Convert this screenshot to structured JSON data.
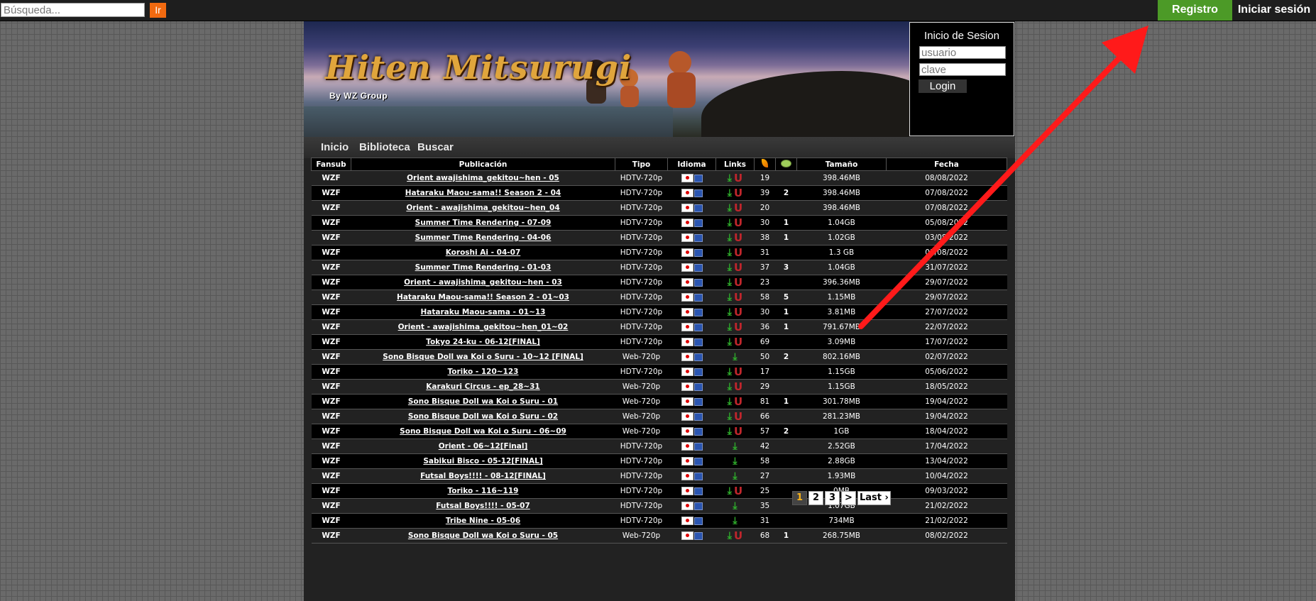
{
  "topbar": {
    "search_placeholder": "Búsqueda...",
    "go_label": "Ir",
    "registro_label": "Registro",
    "iniciar_label": "Iniciar sesión"
  },
  "header": {
    "logo_text": "Hiten Mitsurugi",
    "logo_sub": "By WZ Group"
  },
  "login": {
    "title": "Inicio de Sesion",
    "user_placeholder": "usuario",
    "pass_placeholder": "clave",
    "button": "Login"
  },
  "nav": [
    "Inicio",
    "Biblioteca",
    "Buscar"
  ],
  "table": {
    "headers": [
      "Fansub",
      "Publicación",
      "Tipo",
      "Idioma",
      "Links",
      "seeds-icon",
      "comments-icon",
      "Tamaño",
      "Fecha"
    ],
    "rows": [
      {
        "fansub": "WZF",
        "title": "Orient awajishima_gekitou~hen - 05",
        "tipo": "HDTV-720p",
        "torrent": true,
        "seeds": "19",
        "comments": "",
        "size": "398.46MB",
        "date": "08/08/2022"
      },
      {
        "fansub": "WZF",
        "title": "Hataraku Maou-sama!! Season 2 - 04",
        "tipo": "HDTV-720p",
        "torrent": true,
        "seeds": "39",
        "comments": "2",
        "size": "398.46MB",
        "date": "07/08/2022"
      },
      {
        "fansub": "WZF",
        "title": "Orient - awajishima_gekitou~hen_04",
        "tipo": "HDTV-720p",
        "torrent": true,
        "seeds": "20",
        "comments": "",
        "size": "398.46MB",
        "date": "07/08/2022"
      },
      {
        "fansub": "WZF",
        "title": "Summer Time Rendering - 07-09",
        "tipo": "HDTV-720p",
        "torrent": true,
        "seeds": "30",
        "comments": "1",
        "size": "1.04GB",
        "date": "05/08/2022"
      },
      {
        "fansub": "WZF",
        "title": "Summer Time Rendering - 04-06",
        "tipo": "HDTV-720p",
        "torrent": true,
        "seeds": "38",
        "comments": "1",
        "size": "1.02GB",
        "date": "03/08/2022"
      },
      {
        "fansub": "WZF",
        "title": "Koroshi Ai - 04-07",
        "tipo": "HDTV-720p",
        "torrent": true,
        "seeds": "31",
        "comments": "",
        "size": "1.3 GB",
        "date": "01/08/2022"
      },
      {
        "fansub": "WZF",
        "title": "Summer Time Rendering - 01-03",
        "tipo": "HDTV-720p",
        "torrent": true,
        "seeds": "37",
        "comments": "3",
        "size": "1.04GB",
        "date": "31/07/2022"
      },
      {
        "fansub": "WZF",
        "title": "Orient - awajishima_gekitou~hen - 03",
        "tipo": "HDTV-720p",
        "torrent": true,
        "seeds": "23",
        "comments": "",
        "size": "396.36MB",
        "date": "29/07/2022"
      },
      {
        "fansub": "WZF",
        "title": "Hataraku Maou-sama!! Season 2 - 01~03",
        "tipo": "HDTV-720p",
        "torrent": true,
        "seeds": "58",
        "comments": "5",
        "size": "1.15MB",
        "date": "29/07/2022"
      },
      {
        "fansub": "WZF",
        "title": "Hataraku Maou-sama - 01~13",
        "tipo": "HDTV-720p",
        "torrent": true,
        "seeds": "30",
        "comments": "1",
        "size": "3.81MB",
        "date": "27/07/2022"
      },
      {
        "fansub": "WZF",
        "title": "Orient - awajishima_gekitou~hen_01~02",
        "tipo": "HDTV-720p",
        "torrent": true,
        "seeds": "36",
        "comments": "1",
        "size": "791.67MB",
        "date": "22/07/2022"
      },
      {
        "fansub": "WZF",
        "title": "Tokyo 24-ku - 06-12[FINAL]",
        "tipo": "HDTV-720p",
        "torrent": true,
        "seeds": "69",
        "comments": "",
        "size": "3.09MB",
        "date": "17/07/2022"
      },
      {
        "fansub": "WZF",
        "title": "Sono Bisque Doll wa Koi o Suru - 10~12 [FINAL]",
        "tipo": "Web-720p",
        "torrent": false,
        "seeds": "50",
        "comments": "2",
        "size": "802.16MB",
        "date": "02/07/2022"
      },
      {
        "fansub": "WZF",
        "title": "Toriko - 120~123",
        "tipo": "HDTV-720p",
        "torrent": true,
        "seeds": "17",
        "comments": "",
        "size": "1.15GB",
        "date": "05/06/2022"
      },
      {
        "fansub": "WZF",
        "title": "Karakuri Circus - ep_28~31",
        "tipo": "Web-720p",
        "torrent": true,
        "seeds": "29",
        "comments": "",
        "size": "1.15GB",
        "date": "18/05/2022"
      },
      {
        "fansub": "WZF",
        "title": "Sono Bisque Doll wa Koi o Suru - 01",
        "tipo": "Web-720p",
        "torrent": true,
        "seeds": "81",
        "comments": "1",
        "size": "301.78MB",
        "date": "19/04/2022"
      },
      {
        "fansub": "WZF",
        "title": "Sono Bisque Doll wa Koi o Suru - 02",
        "tipo": "Web-720p",
        "torrent": true,
        "seeds": "66",
        "comments": "",
        "size": "281.23MB",
        "date": "19/04/2022"
      },
      {
        "fansub": "WZF",
        "title": "Sono Bisque Doll wa Koi o Suru - 06~09",
        "tipo": "Web-720p",
        "torrent": true,
        "seeds": "57",
        "comments": "2",
        "size": "1GB",
        "date": "18/04/2022"
      },
      {
        "fansub": "WZF",
        "title": "Orient - 06~12[Final]",
        "tipo": "HDTV-720p",
        "torrent": false,
        "seeds": "42",
        "comments": "",
        "size": "2.52GB",
        "date": "17/04/2022"
      },
      {
        "fansub": "WZF",
        "title": "Sabikui Bisco - 05-12[FINAL]",
        "tipo": "HDTV-720p",
        "torrent": false,
        "seeds": "58",
        "comments": "",
        "size": "2.88GB",
        "date": "13/04/2022"
      },
      {
        "fansub": "WZF",
        "title": "Futsal Boys!!!! - 08-12[FINAL]",
        "tipo": "HDTV-720p",
        "torrent": false,
        "seeds": "27",
        "comments": "",
        "size": "1.93MB",
        "date": "10/04/2022"
      },
      {
        "fansub": "WZF",
        "title": "Toriko - 116~119",
        "tipo": "HDTV-720p",
        "torrent": true,
        "seeds": "25",
        "comments": "",
        "size": "0MB",
        "date": "09/03/2022"
      },
      {
        "fansub": "WZF",
        "title": "Futsal Boys!!!! - 05-07",
        "tipo": "HDTV-720p",
        "torrent": false,
        "seeds": "35",
        "comments": "",
        "size": "1.07GB",
        "date": "21/02/2022"
      },
      {
        "fansub": "WZF",
        "title": "Tribe Nine - 05-06",
        "tipo": "HDTV-720p",
        "torrent": false,
        "seeds": "31",
        "comments": "",
        "size": "734MB",
        "date": "21/02/2022"
      },
      {
        "fansub": "WZF",
        "title": "Sono Bisque Doll wa Koi o Suru - 05",
        "tipo": "Web-720p",
        "torrent": true,
        "seeds": "68",
        "comments": "1",
        "size": "268.75MB",
        "date": "08/02/2022"
      }
    ]
  },
  "pager": [
    "1",
    "2",
    "3",
    ">",
    "Last ›"
  ],
  "pager_current": "1",
  "colors": {
    "registro_bg": "#4c9a27",
    "go_bg": "#f26a10",
    "annotation_arrow": "#ff1a1a"
  }
}
